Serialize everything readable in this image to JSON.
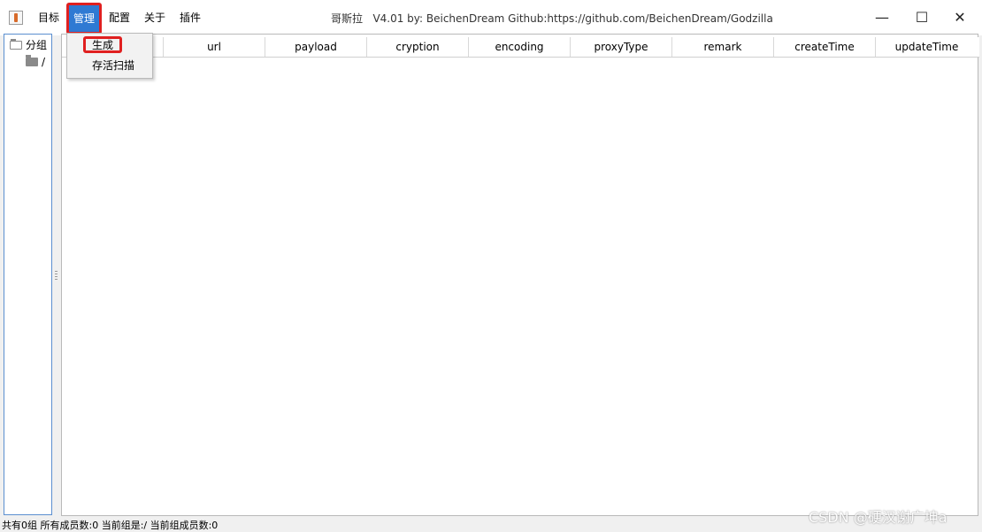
{
  "window": {
    "title": "哥斯拉   V4.01 by: BeichenDream Github:https://github.com/BeichenDream/Godzilla",
    "controls": {
      "minimize": "—",
      "maximize": "☐",
      "close": "✕"
    }
  },
  "menubar": {
    "items": [
      "目标",
      "管理",
      "配置",
      "关于",
      "插件"
    ],
    "active_index": 1
  },
  "dropdown": {
    "items": [
      "生成",
      "存活扫描"
    ]
  },
  "tree": {
    "root": "分组",
    "child": "/"
  },
  "table": {
    "columns": [
      "",
      "url",
      "payload",
      "cryption",
      "encoding",
      "proxyType",
      "remark",
      "createTime",
      "updateTime"
    ]
  },
  "statusbar": {
    "text": "共有0组 所有成员数:0 当前组是:/ 当前组成员数:0"
  },
  "watermark": "CSDN @硬汉谢广坤a",
  "colors": {
    "accent": "#2f7ad3",
    "highlight_box": "#e02020",
    "tree_border": "#5b8fd0"
  }
}
